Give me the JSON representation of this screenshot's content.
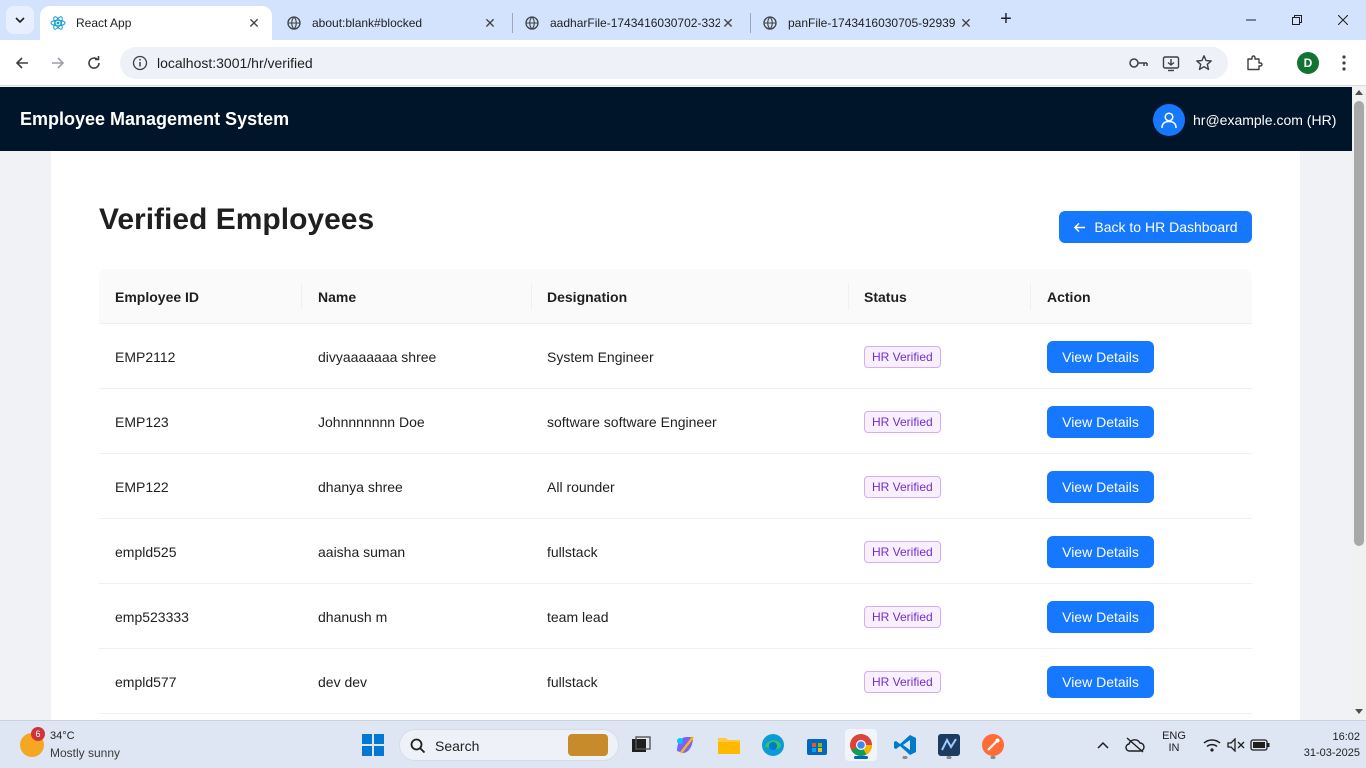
{
  "browser": {
    "tabs": [
      {
        "title": "React App",
        "active": true
      },
      {
        "title": "about:blank#blocked",
        "active": false
      },
      {
        "title": "aadharFile-1743416030702-332",
        "active": false
      },
      {
        "title": "panFile-1743416030705-92939",
        "active": false
      }
    ],
    "url": "localhost:3001/hr/verified",
    "profile_initial": "D"
  },
  "app": {
    "title": "Employee Management System",
    "user": "hr@example.com (HR)"
  },
  "page": {
    "title": "Verified Employees",
    "back_button": "Back to HR Dashboard"
  },
  "table": {
    "headers": [
      "Employee ID",
      "Name",
      "Designation",
      "Status",
      "Action"
    ],
    "rows": [
      {
        "id": "EMP2112",
        "name": "divyaaaaaaa shree",
        "designation": "System Engineer",
        "status": "HR Verified",
        "action": "View Details"
      },
      {
        "id": "EMP123",
        "name": "Johnnnnnnn Doe",
        "designation": "software software Engineer",
        "status": "HR Verified",
        "action": "View Details"
      },
      {
        "id": "EMP122",
        "name": "dhanya shree",
        "designation": "All rounder",
        "status": "HR Verified",
        "action": "View Details"
      },
      {
        "id": "empld525",
        "name": "aaisha suman",
        "designation": "fullstack",
        "status": "HR Verified",
        "action": "View Details"
      },
      {
        "id": "emp523333",
        "name": "dhanush m",
        "designation": "team lead",
        "status": "HR Verified",
        "action": "View Details"
      },
      {
        "id": "empld577",
        "name": "dev dev",
        "designation": "fullstack",
        "status": "HR Verified",
        "action": "View Details"
      }
    ]
  },
  "taskbar": {
    "weather_badge": "6",
    "weather_temp": "34°C",
    "weather_desc": "Mostly sunny",
    "search_label": "Search",
    "lang_top": "ENG",
    "lang_bottom": "IN",
    "time": "16:02",
    "date": "31-03-2025"
  },
  "colors": {
    "header_bg": "#001529",
    "primary": "#1677ff",
    "tag_purple": "#722ed1"
  }
}
